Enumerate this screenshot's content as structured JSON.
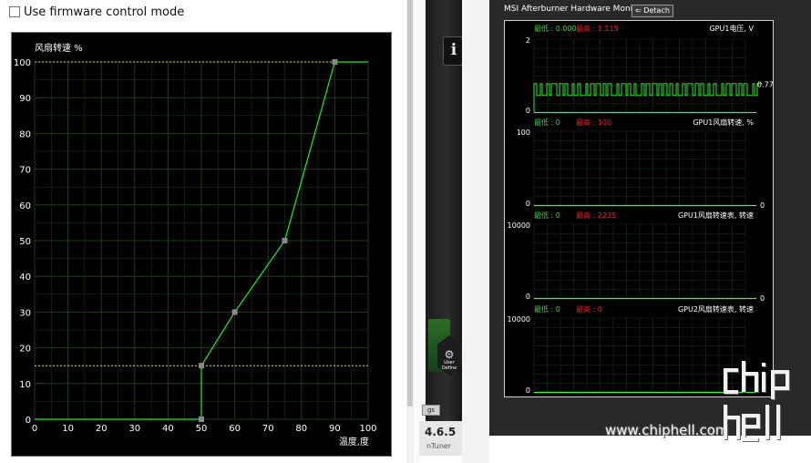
{
  "fan_settings": {
    "firmware_checkbox_label": "Use firmware control mode",
    "firmware_checked": false
  },
  "chart_data": {
    "type": "line",
    "title": "",
    "ylabel": "风扇转速 %",
    "xlabel": "温度,度",
    "xlim": [
      0,
      100
    ],
    "ylim": [
      0,
      100
    ],
    "x_ticks": [
      "0",
      "10",
      "20",
      "30",
      "40",
      "50",
      "60",
      "70",
      "80",
      "90",
      "100"
    ],
    "y_ticks": [
      "0",
      "10",
      "20",
      "30",
      "40",
      "50",
      "60",
      "70",
      "80",
      "90",
      "100"
    ],
    "grid": true,
    "series": [
      {
        "name": "",
        "x": [
          0,
          50,
          50,
          60,
          75,
          90,
          100
        ],
        "y": [
          0,
          0,
          15,
          30,
          50,
          100,
          100
        ]
      }
    ],
    "control_points": [
      {
        "x": 50,
        "y": 0
      },
      {
        "x": 50,
        "y": 15
      },
      {
        "x": 60,
        "y": 30
      },
      {
        "x": 75,
        "y": 50
      },
      {
        "x": 90,
        "y": 100
      }
    ],
    "reference_lines": [
      {
        "axis": "y",
        "value": 100
      },
      {
        "axis": "y",
        "value": 15
      }
    ],
    "colors": {
      "curve": "#22ee22",
      "points": "#8a8a8a",
      "ref": "#d8d060",
      "grid": "#1c3d1c",
      "background": "#000000"
    }
  },
  "skin": {
    "info_glyph": "i",
    "user_define_label": "User Define",
    "button_label": "gs",
    "version": "4.6.5",
    "tuner_label": "nTuner"
  },
  "monitor": {
    "title": "MSI Afterburner Hardware Monitor",
    "detach_label": "⇐ Detach",
    "graphs": [
      {
        "title": "GPU1电压, V",
        "min_label": "最低 : 0.000",
        "max_label": "最高 : 1.115",
        "scale_top": "2",
        "scale_bottom": "0",
        "current_value": "0.775",
        "type": "line",
        "trace_color": "#33ff33"
      },
      {
        "title": "GPU1风扇转速, %",
        "min_label": "最低 : 0",
        "max_label": "最高 : 100",
        "scale_top": "100",
        "scale_bottom": "0",
        "current_value": "0"
      },
      {
        "title": "GPU1风扇转速表, 转速",
        "min_label": "最低 : 0",
        "max_label": "最高 : 2235",
        "scale_top": "10000",
        "scale_bottom": "0",
        "current_value": "0"
      },
      {
        "title": "GPU2风扇转速表, 转速",
        "min_label": "最低 : 0",
        "max_label": "最高 : 0",
        "scale_top": "10000",
        "scale_bottom": "0",
        "current_value": ""
      }
    ]
  },
  "watermark": {
    "site": "www.chiphell.com",
    "logo_text": "chiphell"
  }
}
